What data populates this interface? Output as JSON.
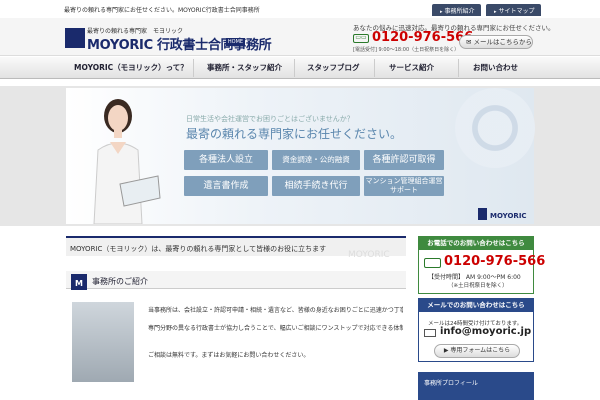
{
  "top": {
    "seo_text": "最寄りの頼れる専門家にお任せください。MOYORIC行政書士合同事務所",
    "tabs": [
      "事務所紹介",
      "サイトマップ"
    ]
  },
  "header": {
    "logo_tagline": "最寄りの頼れる専門家　モヨリック",
    "logo_name": "MOYORIC 行政書士合同事務所",
    "home_label": "HOME",
    "message": "あなたの悩みに迅速対応。最寄りの頼れる専門家にお任せください。",
    "tel_icon": "FREE",
    "phone": "0120-976-566",
    "hours": "[電話受付] 9:00〜18:00（土日祝祭日を除く）",
    "mail_button": "メールはこちらから"
  },
  "nav": {
    "items": [
      "MOYORIC（モヨリック）って？",
      "事務所・スタッフ紹介",
      "スタッフブログ",
      "サービス紹介",
      "お問い合わせ"
    ]
  },
  "hero": {
    "question": "日常生活や会社運営でお困りごとはございませんか？",
    "headline": "最寄の頼れる専門家にお任せください。",
    "services": [
      "各種法人設立",
      "資金調達・公的融資",
      "各種許認可取得",
      "遺言書作成",
      "相続手続き代行",
      "マンション管理組合運営サポート"
    ],
    "brand": "MOYORIC"
  },
  "main": {
    "intro": "MOYORIC（モヨリック）は、最寄りの頼れる専門家として皆様のお役に立ちます",
    "intro_ghost": "MOYORIC",
    "section_icon": "M",
    "section_title": "事務所のご紹介",
    "paragraphs": [
      "当事務所は、会社設立・許認可申請・相続・遺言など、皆様の身近なお困りごとに迅速かつ丁寧に対応いたします。",
      "専門分野の異なる行政書士が協力し合うことで、幅広いご相談にワンストップで対応できる体制を整えております。お気軽にご相談ください。",
      "ご相談は無料です。まずはお気軽にお問い合わせください。"
    ]
  },
  "sidebar": {
    "tel_header": "お電話でのお問い合わせはこちら",
    "tel_number": "0120-976-566",
    "tel_hours": "【受付時間】 AM 9:00〜PM 6:00",
    "tel_note": "（※土日祝祭日を除く）",
    "mail_header": "メールでのお問い合わせはこちら",
    "mail_note": "メールは24時間受け付けております。",
    "mail_address": "info@moyoric.jp",
    "form_button": "専用フォームはこちら",
    "profile_header": "事務所プロフィール"
  },
  "colors": {
    "navy": "#1a2a6c",
    "green": "#3f8a3f",
    "red": "#cc0000",
    "service_blue": "#7f9fbb"
  }
}
